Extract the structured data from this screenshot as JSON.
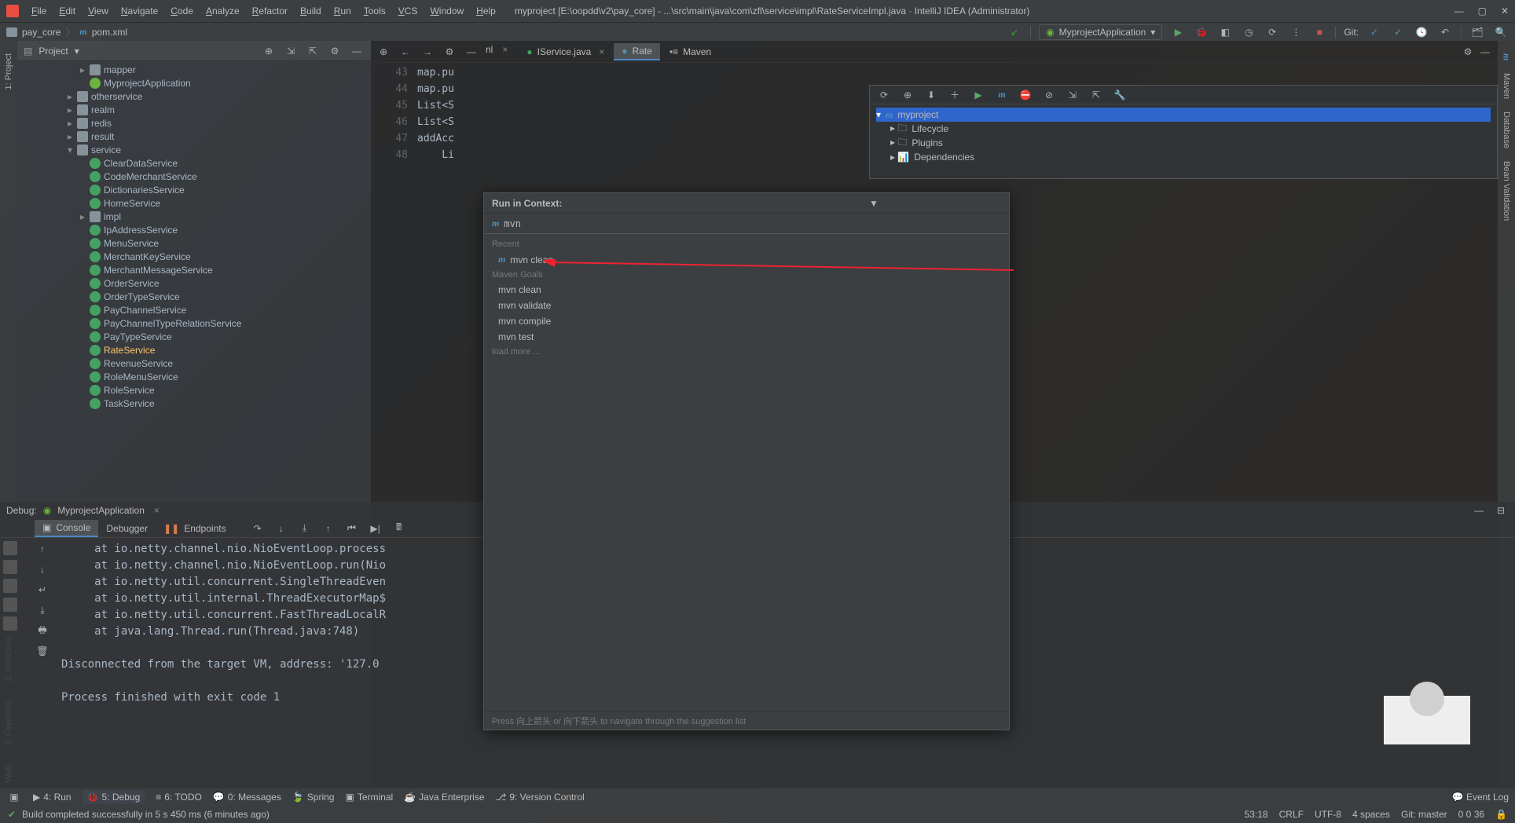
{
  "title": {
    "project": "myproject",
    "path": "[E:\\oopdd\\v2\\pay_core] - ...\\src\\main\\java\\com\\zfl\\service\\impl\\RateServiceImpl.java",
    "app": "IntelliJ IDEA (Administrator)"
  },
  "menu": [
    "File",
    "Edit",
    "View",
    "Navigate",
    "Code",
    "Analyze",
    "Refactor",
    "Build",
    "Run",
    "Tools",
    "VCS",
    "Window",
    "Help"
  ],
  "breadcrumbs": {
    "folder": "pay_core",
    "file": "pom.xml"
  },
  "run_config": "MyprojectApplication",
  "git_label": "Git:",
  "project_panel": {
    "title": "Project",
    "tree": [
      {
        "indent": 3,
        "arrow": "▸",
        "icon": "folder",
        "label": "mapper"
      },
      {
        "indent": 3,
        "arrow": "",
        "icon": "spring",
        "label": "MyprojectApplication"
      },
      {
        "indent": 2,
        "arrow": "▸",
        "icon": "folder",
        "label": "otherservice"
      },
      {
        "indent": 2,
        "arrow": "▸",
        "icon": "folder",
        "label": "realm"
      },
      {
        "indent": 2,
        "arrow": "▸",
        "icon": "folder",
        "label": "redis"
      },
      {
        "indent": 2,
        "arrow": "▸",
        "icon": "folder",
        "label": "result"
      },
      {
        "indent": 2,
        "arrow": "▾",
        "icon": "folder",
        "label": "service"
      },
      {
        "indent": 3,
        "arrow": "",
        "icon": "interface",
        "label": "ClearDataService"
      },
      {
        "indent": 3,
        "arrow": "",
        "icon": "interface",
        "label": "CodeMerchantService"
      },
      {
        "indent": 3,
        "arrow": "",
        "icon": "interface",
        "label": "DictionariesService"
      },
      {
        "indent": 3,
        "arrow": "",
        "icon": "interface",
        "label": "HomeService"
      },
      {
        "indent": 3,
        "arrow": "▸",
        "icon": "folder",
        "label": "impl"
      },
      {
        "indent": 3,
        "arrow": "",
        "icon": "interface",
        "label": "IpAddressService"
      },
      {
        "indent": 3,
        "arrow": "",
        "icon": "interface",
        "label": "MenuService"
      },
      {
        "indent": 3,
        "arrow": "",
        "icon": "interface",
        "label": "MerchantKeyService"
      },
      {
        "indent": 3,
        "arrow": "",
        "icon": "interface",
        "label": "MerchantMessageService"
      },
      {
        "indent": 3,
        "arrow": "",
        "icon": "interface",
        "label": "OrderService"
      },
      {
        "indent": 3,
        "arrow": "",
        "icon": "interface",
        "label": "OrderTypeService"
      },
      {
        "indent": 3,
        "arrow": "",
        "icon": "interface",
        "label": "PayChannelService"
      },
      {
        "indent": 3,
        "arrow": "",
        "icon": "interface",
        "label": "PayChannelTypeRelationService"
      },
      {
        "indent": 3,
        "arrow": "",
        "icon": "interface",
        "label": "PayTypeService"
      },
      {
        "indent": 3,
        "arrow": "",
        "icon": "interface",
        "label": "RateService",
        "highlight": true
      },
      {
        "indent": 3,
        "arrow": "",
        "icon": "interface",
        "label": "RevenueService"
      },
      {
        "indent": 3,
        "arrow": "",
        "icon": "interface",
        "label": "RoleMenuService"
      },
      {
        "indent": 3,
        "arrow": "",
        "icon": "interface",
        "label": "RoleService"
      },
      {
        "indent": 3,
        "arrow": "",
        "icon": "interface",
        "label": "TaskService"
      }
    ]
  },
  "tabs": {
    "extra_left": "nl",
    "items": [
      {
        "label": "IService.java",
        "icon": "interface"
      },
      {
        "label": "Rate",
        "icon": "class",
        "active": true
      },
      {
        "label": "Maven",
        "icon": "maven"
      }
    ]
  },
  "editor": {
    "line_start": 43,
    "lines": [
      "map.pu",
      "map.pu",
      "List<S",
      "List<S",
      "addAcc",
      "    Li"
    ]
  },
  "maven": {
    "root": "myproject",
    "nodes": [
      "Lifecycle",
      "Plugins",
      "Dependencies"
    ]
  },
  "popup": {
    "title": "Run in Context:",
    "input_value": "mvn ",
    "sections": [
      {
        "label": "Recent",
        "items": [
          "mvn clean"
        ]
      },
      {
        "label": "Maven Goals",
        "items": [
          "mvn clean",
          "mvn validate",
          "mvn compile",
          "mvn test"
        ]
      }
    ],
    "load_more": "load more ...",
    "footer": "Press 向上箭头 or 向下箭头 to navigate through the suggestion list"
  },
  "debug": {
    "header": "Debug:",
    "config": "MyprojectApplication",
    "tabs": [
      "Console",
      "Debugger",
      "Endpoints"
    ],
    "console": "     at io.netty.channel.nio.NioEventLoop.process\n     at io.netty.channel.nio.NioEventLoop.run(Nio\n     at io.netty.util.concurrent.SingleThreadEven\n     at io.netty.util.internal.ThreadExecutorMap$\n     at io.netty.util.concurrent.FastThreadLocalR\n     at java.lang.Thread.run(Thread.java:748)\n\nDisconnected from the target VM, address: '127.0\n\nProcess finished with exit code 1"
  },
  "bottom_bar": {
    "items": [
      {
        "icon": "▶",
        "label": "4: Run"
      },
      {
        "icon": "🐞",
        "label": "5: Debug",
        "active": true
      },
      {
        "icon": "≡",
        "label": "6: TODO"
      },
      {
        "icon": "💬",
        "label": "0: Messages"
      },
      {
        "icon": "🍃",
        "label": "Spring"
      },
      {
        "icon": "▣",
        "label": "Terminal"
      },
      {
        "icon": "☕",
        "label": "Java Enterprise"
      },
      {
        "icon": "⎇",
        "label": "9: Version Control"
      }
    ],
    "event_log": "Event Log"
  },
  "status": {
    "message": "Build completed successfully in 5 s 450 ms (6 minutes ago)",
    "pos": "53:18",
    "crlf": "CRLF",
    "enc": "UTF-8",
    "indent": "4 spaces",
    "git": "Git: master",
    "extra": "0 0 36"
  },
  "left_rail": [
    "1: Project",
    "2: Structure",
    "2: Favorites",
    "Web"
  ],
  "right_rail": [
    "Maven",
    "Database",
    "Bean Validation"
  ]
}
